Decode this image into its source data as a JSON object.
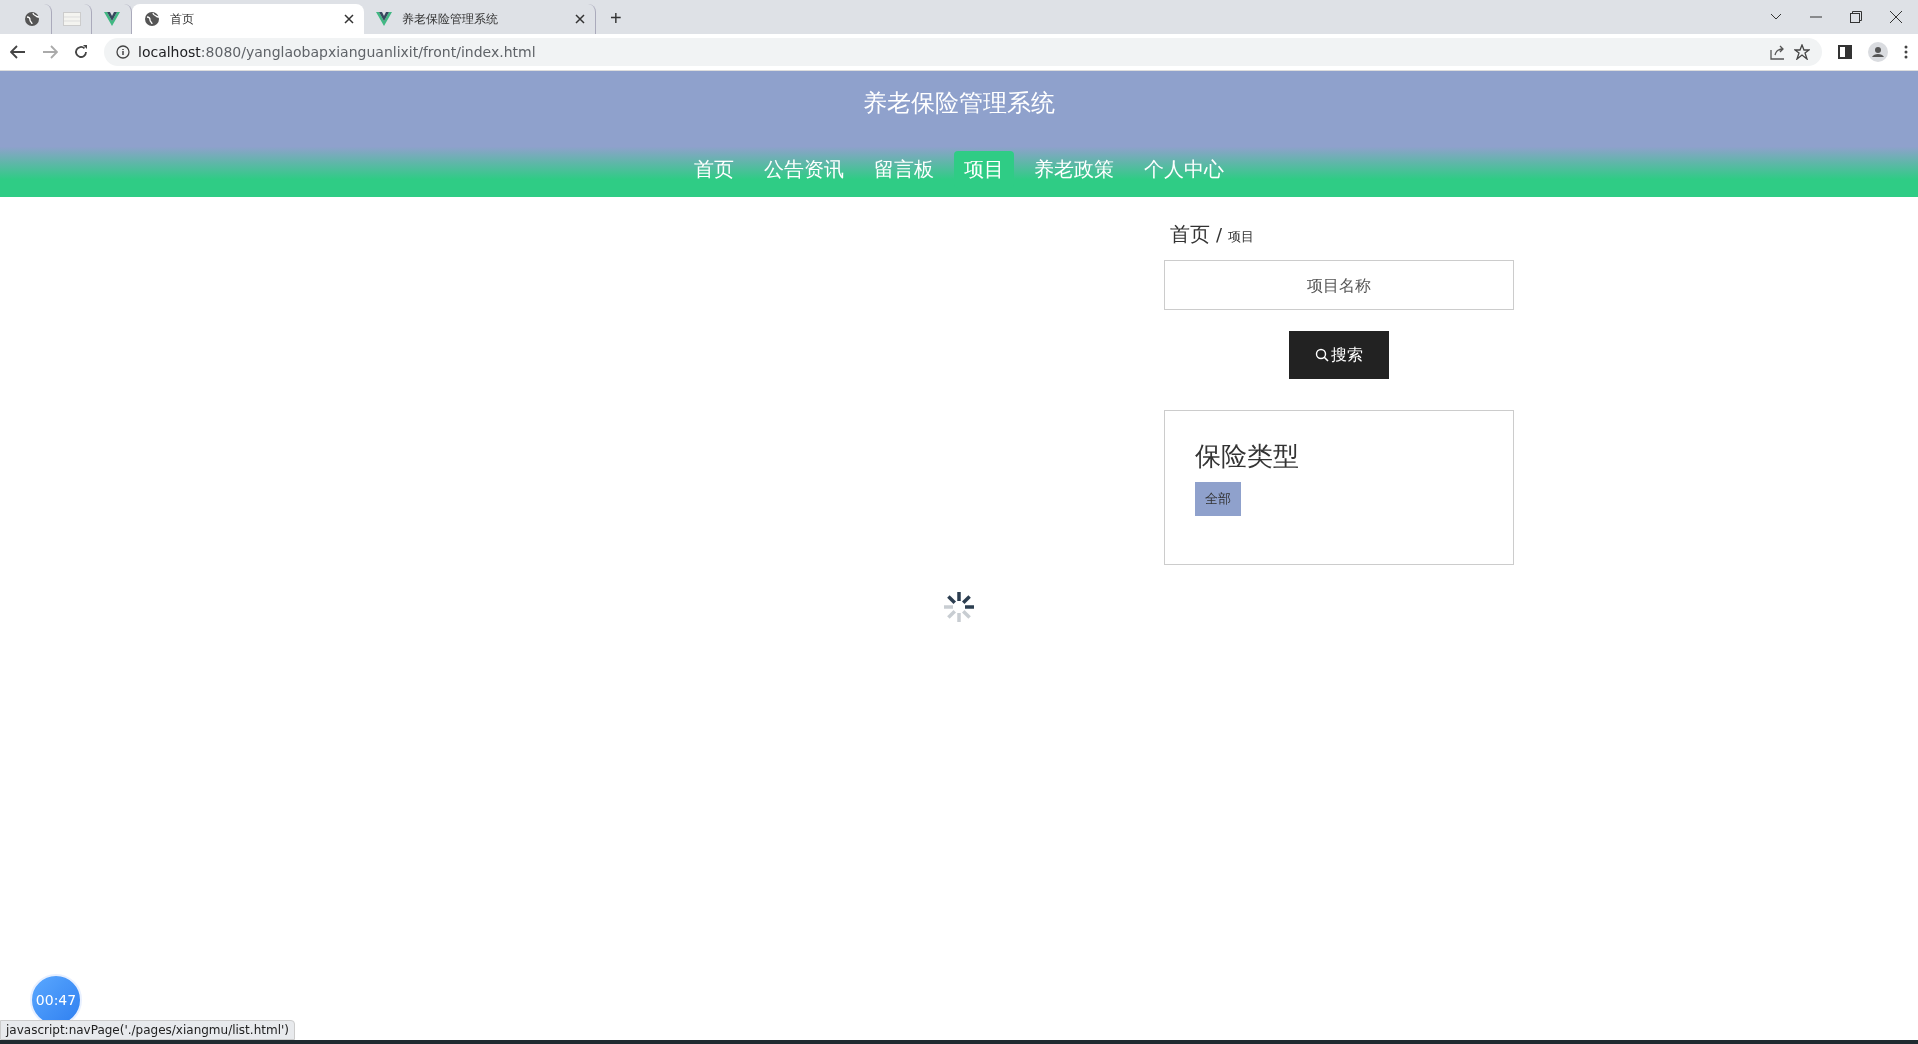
{
  "browser": {
    "tabs": [
      {
        "kind": "globe",
        "pinned": true,
        "selected": false
      },
      {
        "kind": "sheet",
        "pinned": true,
        "selected": false
      },
      {
        "kind": "vue",
        "pinned": true,
        "selected": false
      },
      {
        "kind": "globe",
        "pinned": false,
        "title": "首页",
        "selected": true
      },
      {
        "kind": "vue",
        "pinned": false,
        "title": "养老保险管理系统",
        "selected": false
      }
    ],
    "new_tab": "+",
    "address": {
      "host": "localhost",
      "rest": ":8080/yanglaobapxianguanlixit/front/index.html"
    }
  },
  "header": {
    "title": "养老保险管理系统",
    "nav": [
      {
        "label": "首页",
        "selected": false
      },
      {
        "label": "公告资讯",
        "selected": false
      },
      {
        "label": "留言板",
        "selected": false
      },
      {
        "label": "项目",
        "selected": true
      },
      {
        "label": "养老政策",
        "selected": false
      },
      {
        "label": "个人中心",
        "selected": false
      }
    ]
  },
  "breadcrumb": {
    "home": "首页",
    "separator": "/",
    "current": "项目"
  },
  "search": {
    "placeholder": "项目名称",
    "button": "搜索"
  },
  "category": {
    "title": "保险类型",
    "tags": [
      {
        "label": "全部",
        "selected": true
      }
    ]
  },
  "loading": true,
  "timer": "00:47",
  "status_bar": "javascript:navPage('./pages/xiangmu/list.html')"
}
